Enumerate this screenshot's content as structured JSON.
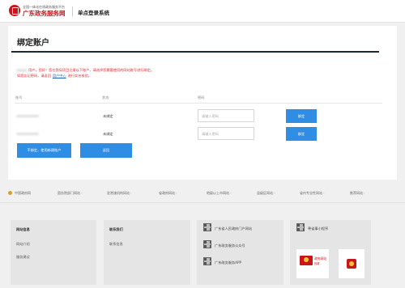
{
  "header": {
    "brand_sub": "全国一体化在线政务服务平台",
    "brand_name": "广东政务服务网",
    "system_title": "单点登录系统"
  },
  "page": {
    "title": "绑定账户",
    "notice_line1": "用户，您好！您在我局项目注册以下账户，请选择您需要使用的网站账号进行绑定。",
    "notice_line2_prefix": "如您忘记密码，请返回",
    "notice_link": "用户中心",
    "notice_line2_suffix": "进行实名核验。"
  },
  "table": {
    "headers": [
      "账号",
      "状态",
      "密码"
    ],
    "rows": [
      {
        "status": "未绑定",
        "password_placeholder": "请输入密码",
        "bind_label": "绑定"
      },
      {
        "status": "未绑定",
        "password_placeholder": "请输入密码",
        "bind_label": "绑定"
      }
    ]
  },
  "actions": {
    "new_account": "不绑定，使用新建账户",
    "back": "返回"
  },
  "gov_links": [
    "中国政府网",
    "国务院部门网站",
    "驻港澳机构网站",
    "省政府网站",
    "地级以上市网站",
    "县级区网站",
    "省内专业性网站",
    "推荐网站"
  ],
  "footer": {
    "site_info": {
      "heading": "网站信息",
      "links": [
        "网站介绍",
        "服务建议"
      ]
    },
    "contact": {
      "heading": "联系我们",
      "links": [
        "联系信息"
      ]
    },
    "qr_items": [
      "广东省人民政府门户网站",
      "广东政务服务公众号",
      "广东政务服务APP"
    ],
    "mini_program": "粤省事小程序",
    "app_badge_text": "政府网站",
    "app_badge_sub": "找错"
  },
  "colors": {
    "primary_blue": "#2f8de4",
    "brand_red": "#c8161d",
    "notice_red": "#e0262c",
    "title_rule": "#1b2a38"
  }
}
